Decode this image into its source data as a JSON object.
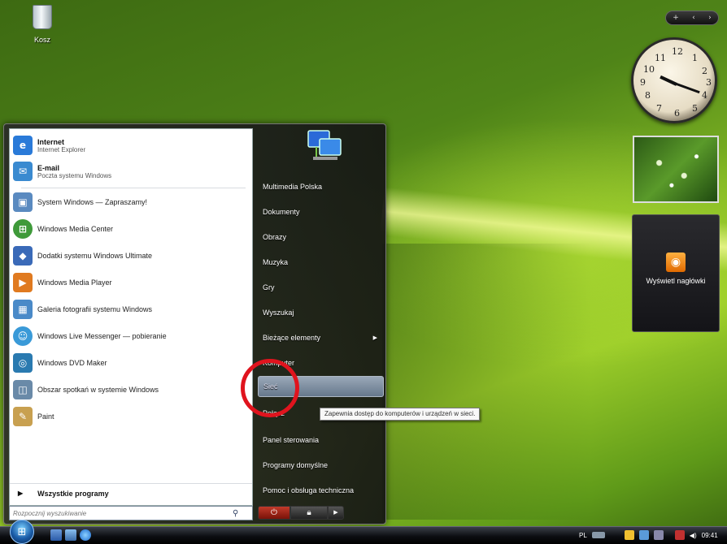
{
  "desktop": {
    "recycle_bin_label": "Kosz"
  },
  "gadgets": {
    "clock_numbers": [
      "12",
      "1",
      "2",
      "3",
      "4",
      "5",
      "6",
      "7",
      "8",
      "9",
      "10",
      "11"
    ],
    "rss_label": "Wyświetl nagłówki"
  },
  "start_menu": {
    "pinned": [
      {
        "title": "Internet",
        "subtitle": "Internet Explorer",
        "icon": "internet-explorer-icon",
        "color": "#2a7ad8"
      },
      {
        "title": "E-mail",
        "subtitle": "Poczta systemu Windows",
        "icon": "mail-icon",
        "color": "#3a8ad0"
      }
    ],
    "recent": [
      {
        "label": "System Windows — Zapraszamy!",
        "icon": "welcome-center-icon",
        "color": "#5a8ac0"
      },
      {
        "label": "Windows Media Center",
        "icon": "media-center-icon",
        "color": "#3f9a3a"
      },
      {
        "label": "Dodatki systemu Windows Ultimate",
        "icon": "ultimate-extras-icon",
        "color": "#3a6ab8"
      },
      {
        "label": "Windows Media Player",
        "icon": "media-player-icon",
        "color": "#e07a20"
      },
      {
        "label": "Galeria fotografii systemu Windows",
        "icon": "photo-gallery-icon",
        "color": "#4a8ac8"
      },
      {
        "label": "Windows Live Messenger — pobieranie",
        "icon": "messenger-icon",
        "color": "#3a9ad8"
      },
      {
        "label": "Windows DVD Maker",
        "icon": "dvd-maker-icon",
        "color": "#2a7ab0"
      },
      {
        "label": "Obszar spotkań w systemie Windows",
        "icon": "meeting-space-icon",
        "color": "#6a8aa8"
      },
      {
        "label": "Paint",
        "icon": "paint-icon",
        "color": "#c8a050"
      }
    ],
    "all_programs": "Wszystkie programy",
    "search_placeholder": "Rozpocznij wyszukiwanie",
    "right_items": [
      {
        "label": "Multimedia Polska",
        "name": "user-folder"
      },
      {
        "label": "Dokumenty",
        "name": "documents"
      },
      {
        "label": "Obrazy",
        "name": "pictures"
      },
      {
        "label": "Muzyka",
        "name": "music"
      },
      {
        "label": "Gry",
        "name": "games"
      },
      {
        "label": "Wyszukaj",
        "name": "search"
      },
      {
        "label": "Bieżące elementy",
        "name": "recent-items"
      },
      {
        "label": "Komputer",
        "name": "computer"
      },
      {
        "label": "Sieć",
        "name": "network"
      },
      {
        "label": "Połącz",
        "name": "connect-to"
      },
      {
        "label": "Panel sterowania",
        "name": "control-panel"
      },
      {
        "label": "Programy domyślne",
        "name": "default-programs"
      },
      {
        "label": "Pomoc i obsługa techniczna",
        "name": "help-support"
      }
    ],
    "tooltip": "Zapewnia dostęp do komputerów i urządzeń w sieci."
  },
  "taskbar": {
    "language": "PL",
    "clock": "09:41"
  }
}
